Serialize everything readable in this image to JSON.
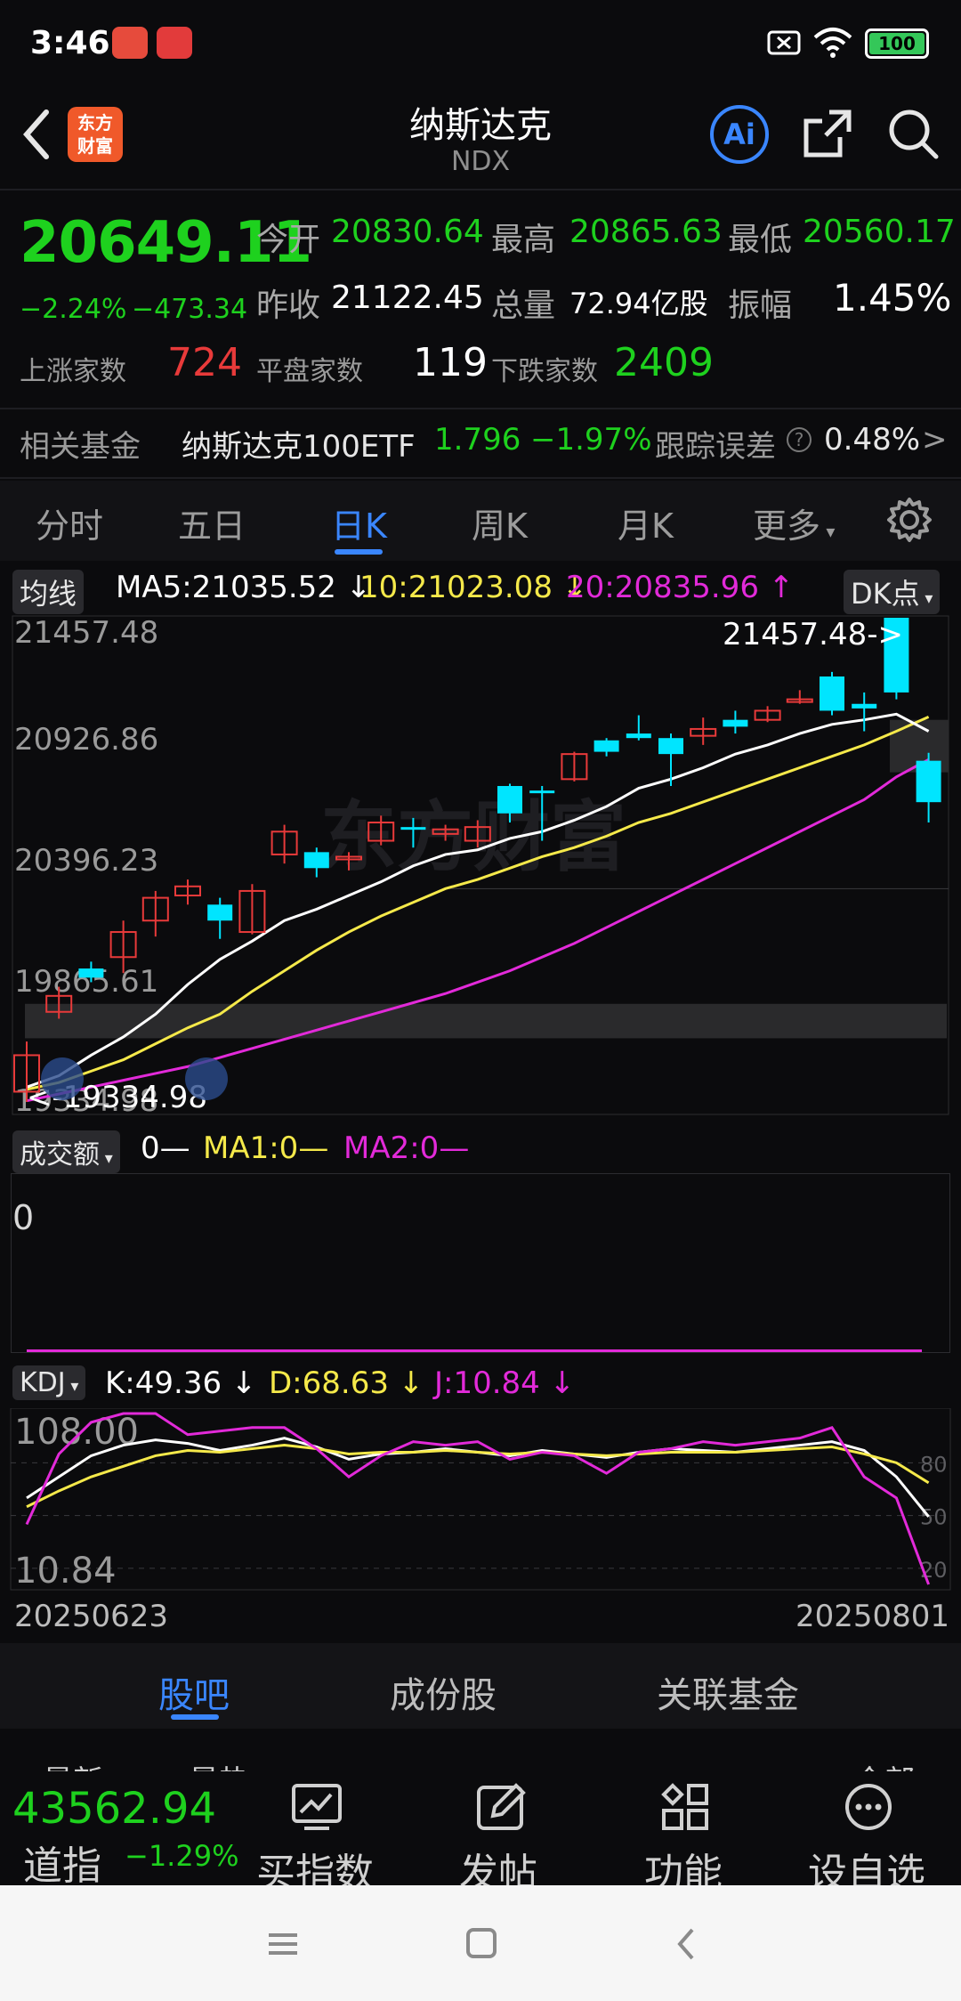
{
  "status_bar": {
    "time": "3:46",
    "battery": "100"
  },
  "header": {
    "title": "纳斯达克",
    "code": "NDX",
    "logo_line1": "东方",
    "logo_line2": "财富",
    "ai_label": "Ai"
  },
  "quote": {
    "price": "20649.11",
    "change_pct": "−2.24%",
    "change_abs": "−473.34",
    "open_label": "今开",
    "open": "20830.64",
    "high_label": "最高",
    "high": "20865.63",
    "low_label": "最低",
    "low": "20560.17",
    "prev_close_label": "昨收",
    "prev_close": "21122.45",
    "volume_label": "总量",
    "volume": "72.94亿股",
    "amplitude_label": "振幅",
    "amplitude": "1.45%",
    "up_label": "上涨家数",
    "up": "724",
    "flat_label": "平盘家数",
    "flat": "119",
    "down_label": "下跌家数",
    "down": "2409"
  },
  "fund": {
    "label": "相关基金",
    "name": "纳斯达克100ETF",
    "price": "1.796",
    "change": "−1.97%",
    "tracking_label": "跟踪误差",
    "tracking": "0.48%",
    "arrow": ">"
  },
  "tabs": [
    {
      "label": "分时"
    },
    {
      "label": "五日"
    },
    {
      "label": "日K"
    },
    {
      "label": "周K"
    },
    {
      "label": "月K"
    },
    {
      "label": "更多"
    }
  ],
  "active_tab": "日K",
  "ma_legend": {
    "selector": "均线",
    "ma5": "MA5:21035.52",
    "ma10": "10:21023.08",
    "ma20": "20:20835.96",
    "dk": "DK点",
    "colors": {
      "ma5": "#ffffff",
      "ma10": "#f5e94a",
      "ma20": "#e22ad9"
    }
  },
  "chart_axis": {
    "y_labels": [
      "21457.48",
      "20926.86",
      "20396.23",
      "19865.61",
      "19334.98"
    ],
    "high_marker": "21457.48->",
    "low_marker": "<-19334.98",
    "x_start": "20250623",
    "x_end": "20250801",
    "watermark": "东方财富"
  },
  "volume_panel": {
    "selector": "成交额",
    "v": "0—",
    "ma1": "MA1:0—",
    "ma2": "MA2:0—",
    "y_label": "0"
  },
  "kdj_panel": {
    "selector": "KDJ",
    "k": "K:49.36",
    "d": "D:68.63",
    "j": "J:10.84",
    "top_label": "108.00",
    "bottom_label": "10.84",
    "ref_80": "80",
    "ref_50": "50",
    "ref_20": "20"
  },
  "chart_data": [
    {
      "type": "candlestick",
      "title": "",
      "ylim": [
        19334.98,
        21457.48
      ],
      "up_color": "#e83a3a",
      "down_color": "#00e5ff",
      "candles": [
        {
          "o": 19380,
          "c": 19540,
          "h": 19600,
          "l": 19334.98
        },
        {
          "o": 19730,
          "c": 19800,
          "h": 19840,
          "l": 19700
        },
        {
          "o": 19920,
          "c": 19880,
          "h": 19950,
          "l": 19860
        },
        {
          "o": 19970,
          "c": 20080,
          "h": 20130,
          "l": 19900
        },
        {
          "o": 20130,
          "c": 20230,
          "h": 20260,
          "l": 20060
        },
        {
          "o": 20240,
          "c": 20280,
          "h": 20310,
          "l": 20200
        },
        {
          "o": 20200,
          "c": 20130,
          "h": 20230,
          "l": 20050
        },
        {
          "o": 20080,
          "c": 20260,
          "h": 20290,
          "l": 20070
        },
        {
          "o": 20420,
          "c": 20520,
          "h": 20550,
          "l": 20380
        },
        {
          "o": 20430,
          "c": 20360,
          "h": 20450,
          "l": 20320
        },
        {
          "o": 20400,
          "c": 20410,
          "h": 20430,
          "l": 20350
        },
        {
          "o": 20480,
          "c": 20560,
          "h": 20590,
          "l": 20460
        },
        {
          "o": 20540,
          "c": 20530,
          "h": 20580,
          "l": 20450
        },
        {
          "o": 20510,
          "c": 20530,
          "h": 20550,
          "l": 20480
        },
        {
          "o": 20480,
          "c": 20540,
          "h": 20570,
          "l": 20450
        },
        {
          "o": 20720,
          "c": 20600,
          "h": 20730,
          "l": 20560
        },
        {
          "o": 20700,
          "c": 20690,
          "h": 20720,
          "l": 20480
        },
        {
          "o": 20750,
          "c": 20860,
          "h": 20870,
          "l": 20740
        },
        {
          "o": 20920,
          "c": 20870,
          "h": 20930,
          "l": 20850
        },
        {
          "o": 20950,
          "c": 20930,
          "h": 21030,
          "l": 20920
        },
        {
          "o": 20930,
          "c": 20860,
          "h": 20950,
          "l": 20720
        },
        {
          "o": 20940,
          "c": 20970,
          "h": 21020,
          "l": 20900
        },
        {
          "o": 21010,
          "c": 20980,
          "h": 21050,
          "l": 20950
        },
        {
          "o": 21010,
          "c": 21050,
          "h": 21070,
          "l": 21000
        },
        {
          "o": 21100,
          "c": 21100,
          "h": 21140,
          "l": 21080
        },
        {
          "o": 21200,
          "c": 21050,
          "h": 21220,
          "l": 21030
        },
        {
          "o": 21080,
          "c": 21060,
          "h": 21130,
          "l": 20960
        },
        {
          "o": 21457.48,
          "c": 21130,
          "h": 21457.48,
          "l": 21100
        },
        {
          "o": 20830.64,
          "c": 20649.11,
          "h": 20865.63,
          "l": 20560.17
        }
      ],
      "ma5": [
        19400,
        19450,
        19540,
        19620,
        19720,
        19850,
        19960,
        20040,
        20130,
        20180,
        20240,
        20300,
        20370,
        20420,
        20440,
        20490,
        20520,
        20570,
        20630,
        20710,
        20750,
        20800,
        20860,
        20900,
        20950,
        20990,
        21010,
        21035,
        20960
      ],
      "ma10": [
        19390,
        19420,
        19470,
        19520,
        19590,
        19660,
        19720,
        19820,
        19910,
        20000,
        20080,
        20150,
        20210,
        20270,
        20310,
        20360,
        20410,
        20450,
        20500,
        20560,
        20600,
        20650,
        20700,
        20750,
        20800,
        20850,
        20900,
        20960,
        21023.08
      ],
      "ma20": [
        19340,
        19370,
        19400,
        19430,
        19460,
        19490,
        19530,
        19570,
        19610,
        19650,
        19690,
        19730,
        19770,
        19810,
        19860,
        19910,
        19970,
        20030,
        20100,
        20170,
        20240,
        20310,
        20380,
        20450,
        20520,
        20590,
        20660,
        20760,
        20835.96
      ]
    },
    {
      "type": "line",
      "title": "KDJ",
      "ylim": [
        10.84,
        108.0
      ],
      "reference_lines": [
        80,
        50,
        20
      ],
      "series": [
        {
          "name": "K",
          "color": "#ffffff",
          "values": [
            60,
            72,
            84,
            90,
            93,
            91,
            87,
            90,
            94,
            89,
            82,
            85,
            86,
            88,
            86,
            84,
            87,
            85,
            83,
            86,
            88,
            87,
            86,
            88,
            90,
            92,
            87,
            72,
            49.36
          ]
        },
        {
          "name": "D",
          "color": "#f5e94a",
          "values": [
            55,
            64,
            72,
            78,
            84,
            87,
            86,
            88,
            90,
            88,
            85,
            86,
            86,
            87,
            86,
            85,
            86,
            85,
            84,
            85,
            86,
            86,
            86,
            87,
            88,
            89,
            85,
            80,
            68.63
          ]
        },
        {
          "name": "J",
          "color": "#e22ad9",
          "values": [
            45,
            85,
            103,
            108,
            108,
            96,
            98,
            100,
            100,
            88,
            72,
            84,
            92,
            90,
            92,
            82,
            86,
            84,
            74,
            86,
            88,
            92,
            90,
            92,
            94,
            100,
            72,
            60,
            10.84
          ]
        }
      ]
    }
  ],
  "bottom_tabs": {
    "items": [
      "股吧",
      "成份股",
      "关联基金"
    ],
    "active": "股吧"
  },
  "bottom_partial": {
    "left1": "最新",
    "left2": "最热",
    "right": "全部"
  },
  "bottom_nav": {
    "index_value": "43562.94",
    "index_name": "道指",
    "index_change": "−1.29%",
    "items": [
      "买指数",
      "发帖",
      "功能",
      "设自选"
    ]
  }
}
